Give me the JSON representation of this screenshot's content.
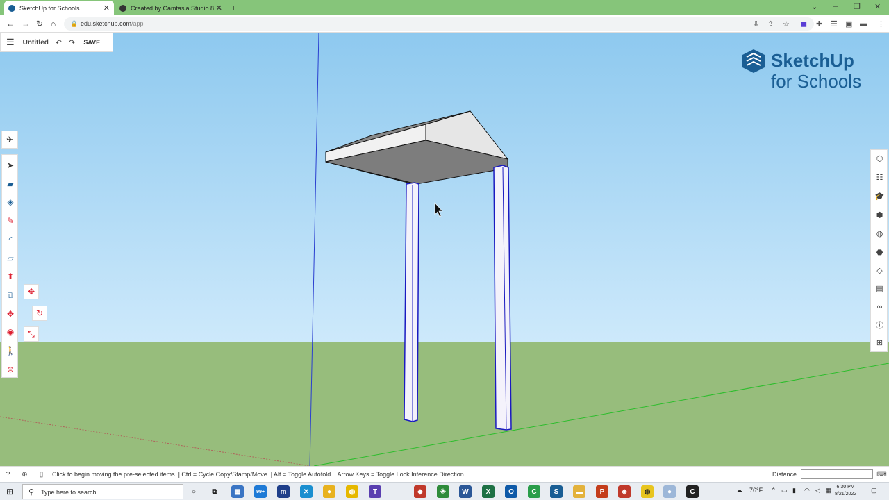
{
  "browser": {
    "tabs": [
      {
        "title": "SketchUp for Schools",
        "active": true,
        "favicon_color": "#1a5e94"
      },
      {
        "title": "Created by Camtasia Studio 8",
        "active": false,
        "favicon_color": "#333333"
      }
    ],
    "url": {
      "host": "edu.sketchup.com",
      "path": "/app"
    }
  },
  "filebar": {
    "title": "Untitled",
    "save_label": "SAVE"
  },
  "logo": {
    "line1": "SketchUp",
    "line2": "for Schools",
    "color": "#1a5e94"
  },
  "status": {
    "message": "Click to begin moving the pre-selected items. | Ctrl = Cycle Copy/Stamp/Move. | Alt = Toggle Autofold. | Arrow Keys = Toggle Lock Inference Direction.",
    "distance_label": "Distance",
    "distance_value": ""
  },
  "taskbar": {
    "search_placeholder": "Type here to search",
    "mail_badge": "99+",
    "temperature": "76°F",
    "time": "6:30 PM",
    "date": "8/21/2022"
  },
  "colors": {
    "sky": "#8ec9ef",
    "ground": "#97bd7c",
    "accent": "#1a5e94"
  }
}
